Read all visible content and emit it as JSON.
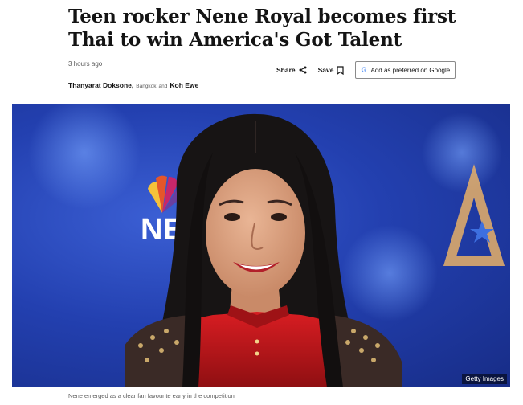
{
  "article": {
    "headline": "Teen rocker Nene Royal becomes first Thai to win America's Got Talent",
    "timestamp": "3 hours ago",
    "authors": {
      "first": "Thanyarat Doksone,",
      "location": "Bangkok",
      "conjunction": "and",
      "second": "Koh Ewe"
    },
    "image_credit": "Getty Images",
    "caption": "Nene emerged as a clear fan favourite early in the competition"
  },
  "toolbar": {
    "share_label": "Share",
    "save_label": "Save",
    "google_label": "Add as preferred on Google",
    "google_icon_glyph": "G"
  },
  "hero_image": {
    "backdrop_text": "NE",
    "backdrop_letter": "A"
  },
  "colors": {
    "backdrop_blue": "#2340b0",
    "dress_red": "#c0161c",
    "google_blue": "#4285f4"
  }
}
